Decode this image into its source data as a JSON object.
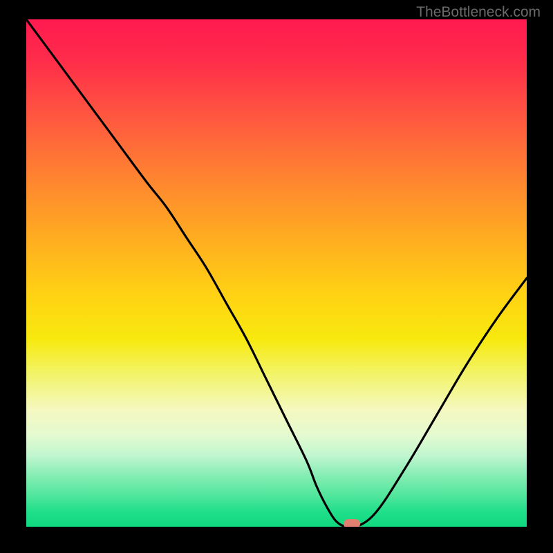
{
  "watermark": "TheBottleneck.com",
  "chart_data": {
    "type": "line",
    "title": "",
    "xlabel": "",
    "ylabel": "",
    "xlim": [
      0,
      100
    ],
    "ylim": [
      0,
      100
    ],
    "x": [
      0,
      6,
      12,
      18,
      24,
      28,
      32,
      36,
      40,
      44,
      48,
      52,
      56,
      58,
      60,
      62,
      64,
      66,
      70,
      76,
      82,
      88,
      94,
      100
    ],
    "values": [
      100,
      92,
      84,
      76,
      68,
      63,
      57,
      51,
      44,
      37,
      29,
      21,
      13,
      8,
      4,
      1,
      0,
      0,
      3,
      12,
      22,
      32,
      41,
      49
    ],
    "minimum_marker": {
      "x": 65,
      "y": 0
    },
    "gradient_colors": {
      "top": "#ff1a50",
      "mid_high": "#ff8a2e",
      "mid": "#ffd413",
      "mid_low": "#f5f8c0",
      "bottom": "#0fd97f"
    }
  }
}
